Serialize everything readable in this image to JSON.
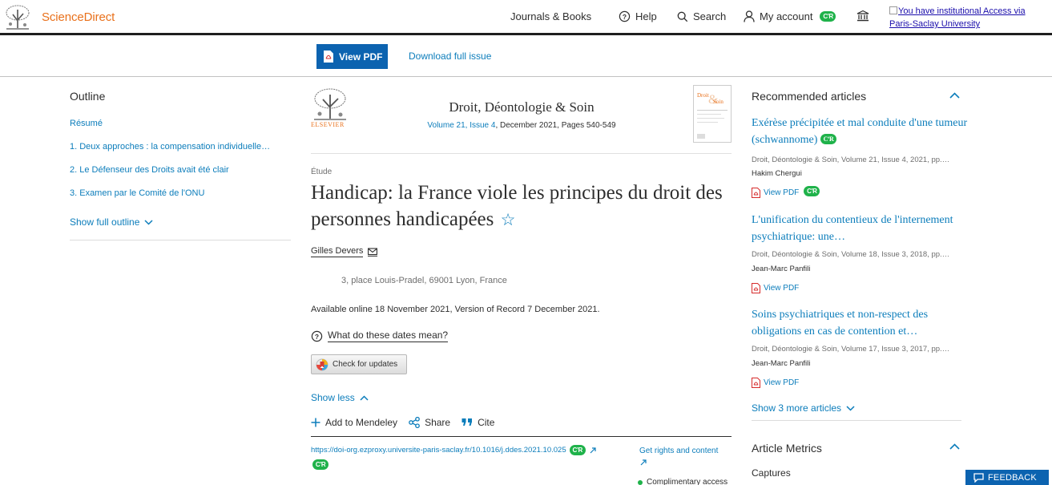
{
  "header": {
    "brand": "ScienceDirect",
    "nav": {
      "journals": "Journals & Books",
      "help": "Help",
      "search": "Search",
      "account": "My account"
    },
    "cr_badge": "C’R",
    "institution_link": "You have institutional Access via Paris-Saclay University"
  },
  "toolbar": {
    "view_pdf": "View PDF",
    "download_issue": "Download full issue"
  },
  "outline": {
    "title": "Outline",
    "items": [
      "Résumé",
      "1. Deux approches : la compensation individuelle…",
      "2. Le Défenseur des Droits avait été clair",
      "3. Examen par le Comité de l'ONU"
    ],
    "show_full": "Show full outline"
  },
  "journal": {
    "publisher": "ELSEVIER",
    "title": "Droit, Déontologie & Soin",
    "volume_link": "Volume 21, Issue 4",
    "volume_rest": ", December 2021, Pages 540-549"
  },
  "article": {
    "type": "Étude",
    "title": "Handicap: la France viole les principes du droit des personnes handicapées",
    "star": "☆",
    "author": "Gilles Devers",
    "affiliation": "3, place Louis-Pradel, 69001 Lyon, France",
    "dates": "Available online 18 November 2021, Version of Record 7 December 2021.",
    "dates_help": "What do these dates mean?",
    "check_updates": "Check for updates",
    "show_less": "Show less",
    "actions": {
      "mendeley": "Add to Mendeley",
      "share": "Share",
      "cite": "Cite"
    },
    "doi": "https://doi-org.ezproxy.universite-paris-saclay.fr/10.1016/j.ddes.2021.10.025",
    "rights": "Get rights and content",
    "access": "Complimentary access"
  },
  "recommended": {
    "title": "Recommended articles",
    "items": [
      {
        "title": "Exérèse précipitée et mal conduite d'une tumeur (schwannome)",
        "meta": "Droit, Déontologie & Soin, Volume 21, Issue 4, 2021, pp.…",
        "author": "Hakim Chergui",
        "pdf": "View PDF"
      },
      {
        "title": "L'unification du contentieux de l'internement psychiatrique: une…",
        "meta": "Droit, Déontologie & Soin, Volume 18, Issue 3, 2018, pp.…",
        "author": "Jean-Marc Panfili",
        "pdf": "View PDF"
      },
      {
        "title": "Soins psychiatriques et non-respect des obligations en cas de contention et…",
        "meta": "Droit, Déontologie & Soin, Volume 17, Issue 3, 2017, pp.…",
        "author": "Jean-Marc Panfili",
        "pdf": "View PDF"
      }
    ],
    "show_more": "Show 3 more articles"
  },
  "metrics": {
    "title": "Article Metrics",
    "captures": "Captures"
  },
  "feedback": "FEEDBACK",
  "colors": {
    "link": "#0c7dbb",
    "brand_orange": "#e9711c",
    "button_blue": "#0c63b0",
    "badge_green": "#1fb24a"
  }
}
